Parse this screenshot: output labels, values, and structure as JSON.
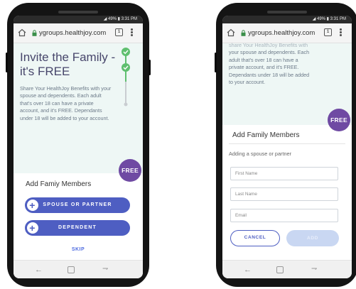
{
  "status_bar": {
    "text": "◢ 49% ▮ 3:31 PM"
  },
  "browser": {
    "url": "ygroups.healthjoy.com",
    "tab_count": "1"
  },
  "left_screen": {
    "title": "Invite the Family - it's FREE",
    "body": "Share Your HealthJoy Benefits with your spouse and dependents. Each adult that's over 18 can have a private account, and it's FREE. Dependants under 18 will be added to your account.",
    "badge": "FREE",
    "section_title": "Add Famiy Members",
    "spouse_button": "SPOUSE OR PARTNER",
    "dependent_button": "DEPENDENT",
    "skip": "SKIP"
  },
  "right_screen": {
    "body_lines": [
      "share Your HealthJoy Benefits with",
      "your spouse and dependents. Each",
      "adult that's over 18 can have a",
      "private account, and it's FREE.",
      "Dependants under 18 will be added",
      "to your account."
    ],
    "badge": "FREE",
    "section_title": "Add Family Members",
    "subtitle": "Adding a spouse or partner",
    "fields": {
      "first_name": "First Name",
      "last_name": "Last Name",
      "email": "Email"
    },
    "cancel": "CANCEL",
    "add": "ADD"
  },
  "colors": {
    "brand_purple": "#6f4aa3",
    "button_blue": "#4e5ec2",
    "progress_green": "#5fbf6f",
    "mint_bg": "#eef7f5"
  },
  "icons": [
    "home-icon",
    "lock-icon",
    "tabs-icon",
    "overflow-menu-icon",
    "back-icon",
    "home-nav-icon",
    "recents-icon",
    "plus-icon",
    "check-icon"
  ]
}
